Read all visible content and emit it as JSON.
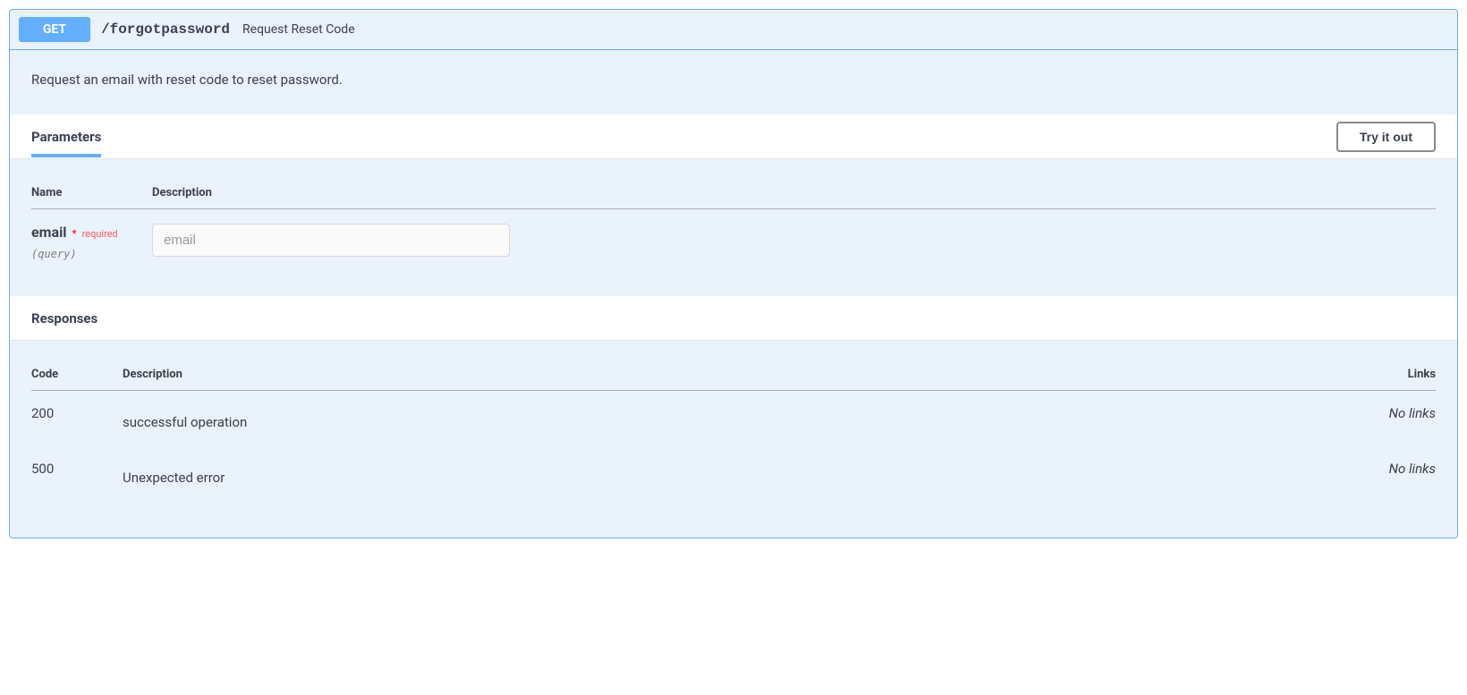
{
  "header": {
    "method": "GET",
    "path": "/forgotpassword",
    "summary": "Request Reset Code"
  },
  "description": "Request an email with reset code to reset password.",
  "sections": {
    "parameters_title": "Parameters",
    "responses_title": "Responses",
    "try_it_out": "Try it out"
  },
  "param_headers": {
    "name": "Name",
    "description": "Description"
  },
  "parameters": [
    {
      "name": "email",
      "required_label": "required",
      "in": "(query)",
      "placeholder": "email",
      "value": ""
    }
  ],
  "response_headers": {
    "code": "Code",
    "description": "Description",
    "links": "Links"
  },
  "responses": [
    {
      "code": "200",
      "description": "successful operation",
      "links": "No links"
    },
    {
      "code": "500",
      "description": "Unexpected error",
      "links": "No links"
    }
  ]
}
